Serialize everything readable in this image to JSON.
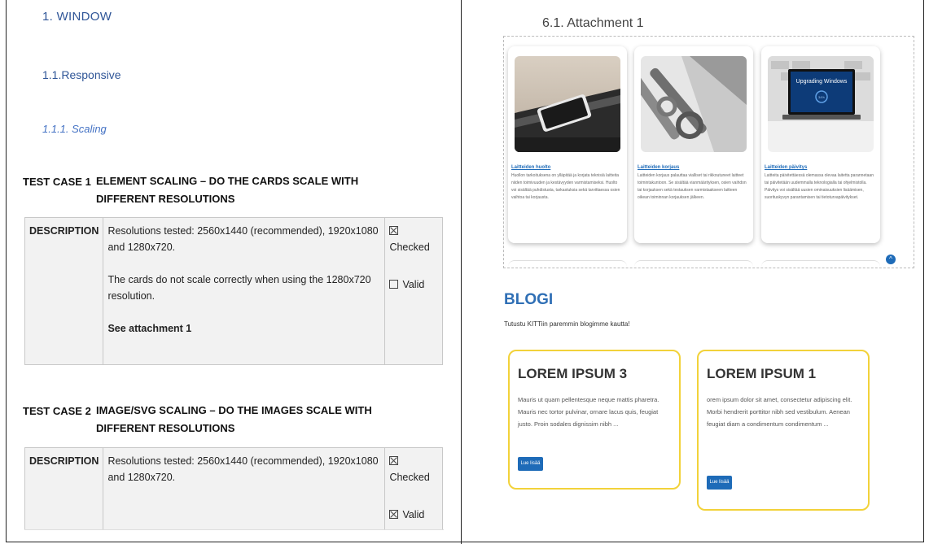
{
  "doc": {
    "h1": "1.  WINDOW",
    "h2": "1.1.Responsive",
    "h3": "1.1.1.   Scaling",
    "test_cases": [
      {
        "id": "TEST CASE 1",
        "title": "ELEMENT SCALING – DO THE CARDS SCALE WITH DIFFERENT RESOLUTIONS",
        "label": "DESCRIPTION",
        "p1": "Resolutions tested: 2560x1440 (recommended), 1920x1080 and 1280x720.",
        "p2": "The cards do not scale correctly when using the 1280x720 resolution.",
        "p3": "See attachment 1",
        "checked_label": "Checked",
        "valid_label": "Valid"
      },
      {
        "id": "TEST CASE 2",
        "title": "IMAGE/SVG SCALING – DO THE IMAGES SCALE WITH DIFFERENT RESOLUTIONS",
        "label": "DESCRIPTION",
        "p1": "Resolutions tested: 2560x1440 (recommended), 1920x1080 and 1280x720.",
        "checked_label": "Checked",
        "valid_label": "Valid"
      }
    ]
  },
  "attachment": {
    "title": "6.1. Attachment 1",
    "cards": [
      {
        "title": "Laitteiden huolto",
        "body": "Huollon tarkoituksena on ylläpitää ja korjata teknisiä laitteita niiden toimivuuden ja kestävyyden varmistamiseksi. Huolto voi sisältää puhdistusta, tarkastuksia sekä tarvittaessa osien vaihtoa tai korjausta."
      },
      {
        "title": "Laitteiden korjaus",
        "body": "Laitteiden korjaus palauttaa vialliset tai rikkoutuneet laitteet toimintakuntoon. Se sisältää vianmäärityksen, osien vaihdon tai korjauksen sekä testauksen varmistaakseen laitteen oikean toiminnan korjauksen jälkeen."
      },
      {
        "title": "Laitteiden päivitys",
        "body": "Laitteita päivitettäessä olemassa olevaa laitetta parannetaan tai päivitetään uudemmalla teknologialla tai ohjelmistolla. Päivitys voi sisältää uusien ominaisuuksien lisäämisen, suorituskyvyn parantamisen tai tietoturvapäivitykset."
      }
    ],
    "upgrade_text": "Upgrading Windows",
    "upgrade_pct": "34%"
  },
  "blog": {
    "title": "BLOGI",
    "subtitle": "Tutustu KITTiin paremmin blogimme kautta!",
    "cards": [
      {
        "title": "LOREM IPSUM 3",
        "text": "Mauris ut quam pellentesque neque mattis pharetra. Mauris nec tortor pulvinar, ornare lacus quis, feugiat justo. Proin sodales dignissim nibh ...",
        "button": "Lue lisää"
      },
      {
        "title": "LOREM IPSUM 1",
        "text": "orem ipsum dolor sit amet, consectetur adipiscing elit. Morbi hendrerit porttitor nibh sed vestibulum. Aenean feugiat diam a condimentum condimentum ...",
        "button": "Lue lisää"
      }
    ]
  }
}
